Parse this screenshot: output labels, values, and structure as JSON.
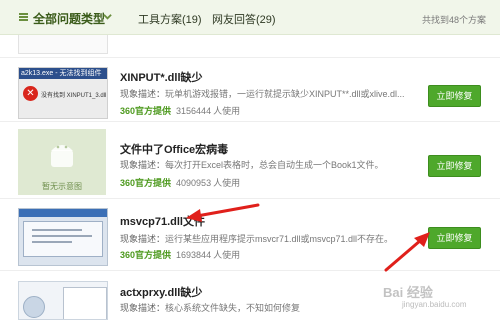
{
  "header": {
    "category_label": "全部问题类型",
    "tabs": [
      {
        "label": "工具方案(19)"
      },
      {
        "label": "网友回答(29)"
      }
    ],
    "total_text": "共找到48个方案"
  },
  "desc_label": "现象描述：",
  "usage_suffix": "人使用",
  "fix_button_label": "立即修复",
  "results": [
    {
      "thumb_caption": "a2k13.exe - 无法找到组件",
      "thumb_message": "没有找到 XINPUT1_3.dll",
      "title": "XINPUT*.dll缺少",
      "desc": "玩单机游戏报错，一运行就提示缺少XINPUT**.dll或xlive.dl...",
      "source": "360官方提供",
      "count": "3156444"
    },
    {
      "thumb_caption": "暂无示意图",
      "title": "文件中了Office宏病毒",
      "desc": "每次打开Excel表格时，总会自动生成一个Book1文件。",
      "source": "360官方提供",
      "count": "4090953"
    },
    {
      "title": "msvcp71.dll文件",
      "desc": "运行某些应用程序提示msvcr71.dll或msvcp71.dll不存在。",
      "source": "360官方提供",
      "count": "1693844"
    },
    {
      "title": "actxprxy.dll缺少",
      "desc": "核心系统文件缺失，不知如何修复"
    }
  ],
  "watermark": "Bai 经验",
  "watermark_sub": "jingyan.baidu.com",
  "colors": {
    "accent_green": "#4ea82b",
    "source_green": "#4e9a1f",
    "arrow_red": "#e0201b",
    "header_bg": "#f1f6ea"
  },
  "icons": [
    "list-icon",
    "chevron-down-icon",
    "error-icon",
    "android-placeholder-icon"
  ]
}
